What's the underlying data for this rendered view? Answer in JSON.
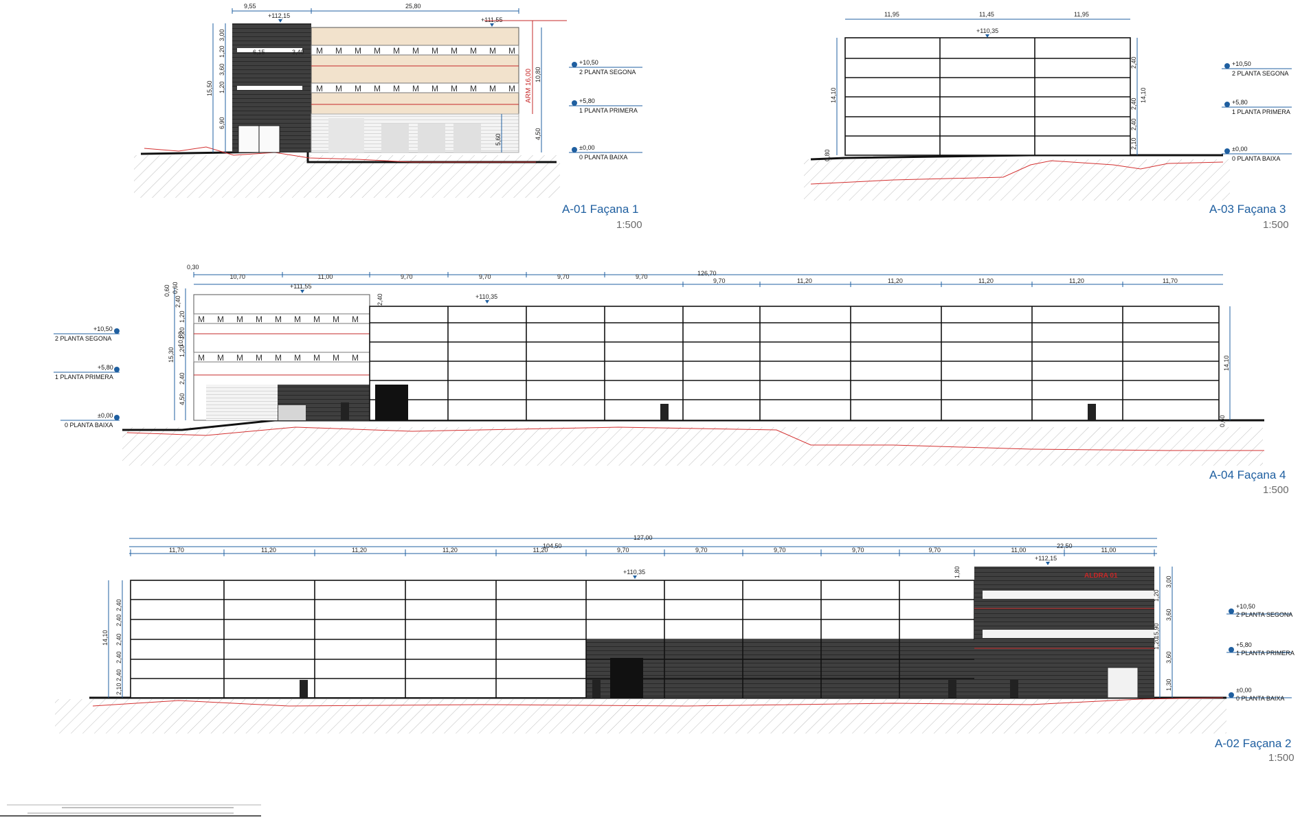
{
  "colors": {
    "title": "#1f5fa0",
    "dimension": "#1f5fa0",
    "terrain_line": "#d32f2f",
    "dark_cladding": "#3a3a3a",
    "beige_panel": "#f2e2cc"
  },
  "levels": [
    {
      "elev": "+10,50",
      "name": "2 PLANTA SEGONA"
    },
    {
      "elev": "+5,80",
      "name": "1 PLANTA PRIMERA"
    },
    {
      "elev": "±0,00",
      "name": "0 PLANTA BAIXA"
    }
  ],
  "views": [
    {
      "id": "a01",
      "title": "A-01 Façana 1",
      "scale": "1:500",
      "top_dims": [
        "9,55",
        "25,80"
      ],
      "inner_dims": [
        "6,15",
        "3,40"
      ],
      "side_dims": [
        "3,00",
        "1,20",
        "3,60",
        "1,20",
        "15,50",
        "6,90"
      ],
      "right_dims": [
        "10,80",
        "4,50",
        "5,60"
      ],
      "red_label": "ARM 16,00",
      "tops": [
        "+112,15",
        "+111,55"
      ]
    },
    {
      "id": "a03",
      "title": "A-03 Façana 3",
      "scale": "1:500",
      "top_dims": [
        "11,95",
        "11,45",
        "11,95"
      ],
      "side_dims": [
        "14,10",
        "0,80"
      ],
      "right_dims": [
        "2,40",
        "14,10",
        "2,40",
        "2,40",
        "2,10"
      ],
      "tops": [
        "+110,35"
      ]
    },
    {
      "id": "a04",
      "title": "A-04 Façana 4",
      "scale": "1:500",
      "overall": "126,70",
      "offset": "0,30",
      "top_dims": [
        "10,70",
        "11,00",
        "9,70",
        "9,70",
        "9,70",
        "9,70"
      ],
      "lower_dims": [
        "9,70",
        "11,20",
        "11,20",
        "11,20",
        "11,20",
        "11,70"
      ],
      "side_dims": [
        "0,60",
        "0,60",
        "2,40",
        "1,20",
        "10,80",
        "1,20",
        "1,20",
        "15,30",
        "2,40",
        "4,50"
      ],
      "right_dims": [
        "2,40",
        "14,10",
        "0,60"
      ],
      "tops": [
        "+111,55",
        "+110,35"
      ]
    },
    {
      "id": "a02",
      "title": "A-02 Façana 2",
      "scale": "1:500",
      "overall": "127,00",
      "mid_dims": [
        "104,50",
        "22,50"
      ],
      "bay_dims": [
        "11,70",
        "11,20",
        "11,20",
        "11,20",
        "11,20",
        "9,70",
        "9,70",
        "9,70",
        "9,70",
        "9,70",
        "11,00",
        "11,00"
      ],
      "side_dims": [
        "2,40",
        "2,40",
        "2,40",
        "14,10",
        "2,40",
        "2,40",
        "2,10"
      ],
      "right_dims": [
        "1,80",
        "3,00",
        "1,20",
        "3,60",
        "15,90",
        "1,20",
        "3,60",
        "1,30"
      ],
      "tops": [
        "+112,15",
        "+110,35"
      ],
      "signage": "ALDRA 01"
    }
  ]
}
